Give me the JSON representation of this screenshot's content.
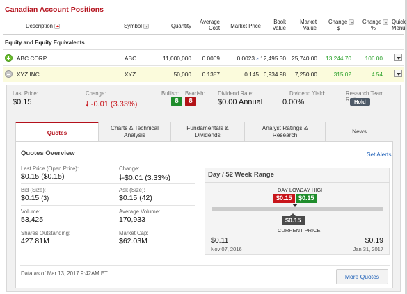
{
  "header": {
    "title": "Canadian Account Positions"
  },
  "columns": {
    "description": "Description",
    "symbol": "Symbol",
    "quantity": "Quantity",
    "avg_cost_1": "Average",
    "avg_cost_2": "Cost",
    "market_price": "Market Price",
    "book_1": "Book",
    "book_2": "Value",
    "market_1": "Market",
    "market_2": "Value",
    "chg_d_1": "Change",
    "chg_d_2": "$",
    "chg_p_1": "Change",
    "chg_p_2": "%",
    "qm_1": "Quick",
    "qm_2": "Menu"
  },
  "group": {
    "title": "Equity and Equity Equivalents"
  },
  "rows": [
    {
      "description": "ABC CORP",
      "symbol": "ABC",
      "quantity": "11,000,000",
      "avg_cost": "0.0009",
      "market_price": "0.0023",
      "book_value": "12,495.30",
      "market_value": "25,740.00",
      "change_dollar": "13,244.70",
      "change_pct": "106.00"
    },
    {
      "description": "XYZ INC",
      "symbol": "XYZ",
      "quantity": "50,000",
      "avg_cost": "0.1387",
      "market_price": "0.145",
      "book_value": "6,934.98",
      "market_value": "7,250.00",
      "change_dollar": "315.02",
      "change_pct": "4.54"
    }
  ],
  "summary": {
    "last_price_label": "Last Price:",
    "last_price": "$0.15",
    "change_label": "Change:",
    "change": "-0.01 (3.33%)",
    "bullish_label": "Bullish:",
    "bullish": "8",
    "bearish_label": "Bearish:",
    "bearish": "8",
    "div_rate_label": "Dividend Rate:",
    "div_rate": "$0.00 Annual",
    "div_yield_label": "Dividend Yield:",
    "div_yield": "0.00%",
    "research_label": "Research Team Rating:",
    "research": "Hold"
  },
  "tabs": [
    {
      "l1": "Quotes",
      "l2": ""
    },
    {
      "l1": "Charts & Technical",
      "l2": "Analysis"
    },
    {
      "l1": "Fundamentals &",
      "l2": "Dividends"
    },
    {
      "l1": "Analyst Ratings &",
      "l2": "Research"
    },
    {
      "l1": "News",
      "l2": ""
    }
  ],
  "quotes": {
    "title": "Quotes Overview",
    "set_alerts": "Set Alerts",
    "last_price_lbl": "Last Price (Open Price):",
    "last_price_val": "$0.15 ($0.15)",
    "change_lbl": "Change:",
    "change_val": "-$0.01 (3.33%)",
    "bid_lbl": "Bid (Size):",
    "bid_val": "$0.15",
    "bid_size": "(3)",
    "ask_lbl": "Ask (Size):",
    "ask_val": "$0.15 (42)",
    "volume_lbl": "Volume:",
    "volume_val": "53,425",
    "avg_volume_lbl": "Average Volume:",
    "avg_volume_val": "170,933",
    "shares_lbl": "Shares Outstanding:",
    "shares_val": "427.81M",
    "mktcap_lbl": "Market Cap:",
    "mktcap_val": "$62.03M",
    "data_as_of": "Data as of Mar 13, 2017 9:42AM ET",
    "more_quotes": "More Quotes"
  },
  "range": {
    "title": "Day / 52 Week Range",
    "day_low_label": "DAY LOW",
    "day_high_label": "DAY HIGH",
    "day_low": "$0.15",
    "day_high": "$0.15",
    "current": "$0.15",
    "current_label": "CURRENT PRICE",
    "low52": "$0.11",
    "low52_date": "Nov 07, 2016",
    "high52": "$0.19",
    "high52_date": "Jan 31, 2017"
  },
  "colors": {
    "brand": "#b4111c",
    "positive": "#2aa12a",
    "negative": "#c8151b",
    "link": "#1c5fb7"
  }
}
